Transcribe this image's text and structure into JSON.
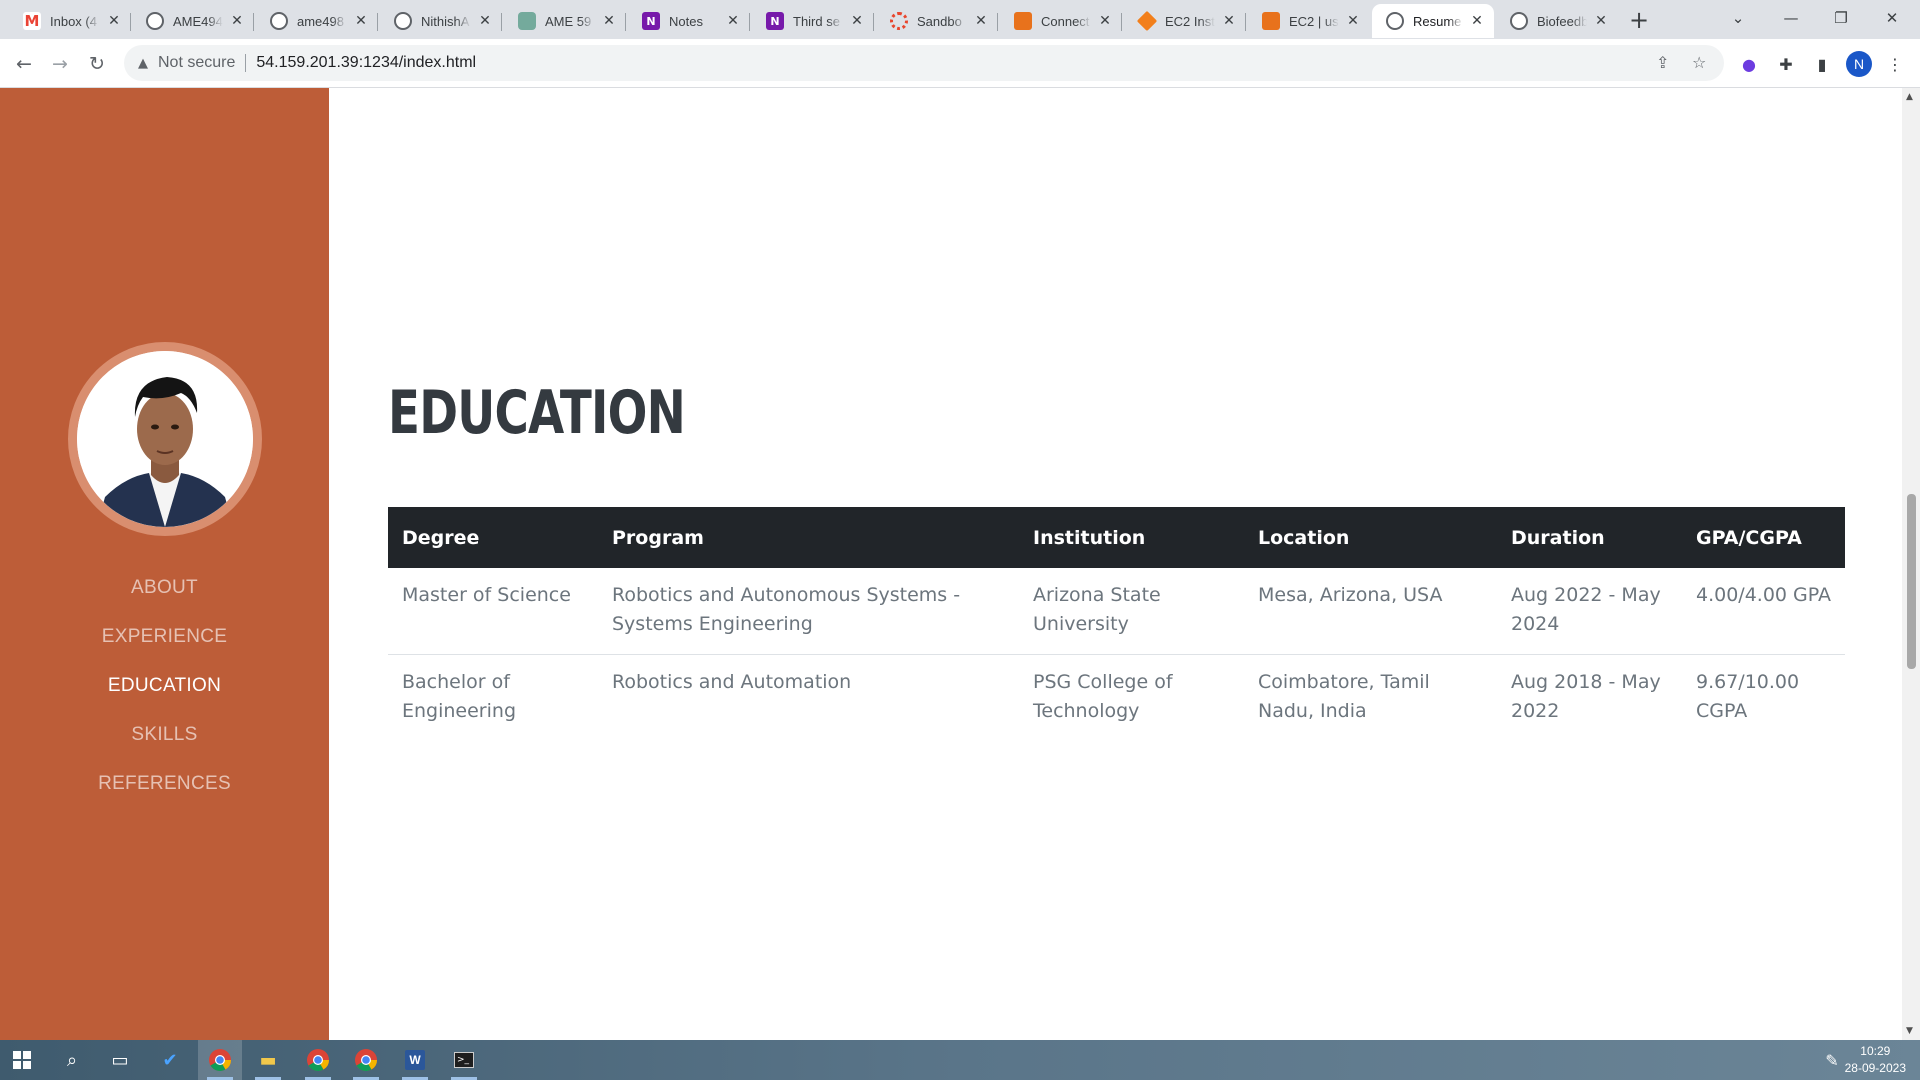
{
  "browser": {
    "tabs": [
      {
        "title": "Inbox (4",
        "icon": "gmail-icon"
      },
      {
        "title": "AME494",
        "icon": "github-icon"
      },
      {
        "title": "ame498",
        "icon": "github-icon"
      },
      {
        "title": "NithishA",
        "icon": "github-icon"
      },
      {
        "title": "AME 59",
        "icon": "chatgpt-icon"
      },
      {
        "title": "Notes",
        "icon": "onenote-icon"
      },
      {
        "title": "Third se",
        "icon": "onenote-icon"
      },
      {
        "title": "Sandbo",
        "icon": "sandbox-icon"
      },
      {
        "title": "Connect",
        "icon": "aws-icon"
      },
      {
        "title": "EC2 Inst",
        "icon": "ec2-icon"
      },
      {
        "title": "EC2 | us",
        "icon": "aws-icon"
      },
      {
        "title": "Resume",
        "icon": "globe-icon",
        "active": true
      },
      {
        "title": "Biofeedb",
        "icon": "github-icon"
      }
    ],
    "security_label": "Not secure",
    "url": "54.159.201.39:1234/index.html",
    "profile_initial": "N"
  },
  "sidebar": {
    "nav": [
      {
        "label": "ABOUT",
        "active": false
      },
      {
        "label": "EXPERIENCE",
        "active": false
      },
      {
        "label": "EDUCATION",
        "active": true
      },
      {
        "label": "SKILLS",
        "active": false
      },
      {
        "label": "REFERENCES",
        "active": false
      }
    ]
  },
  "education": {
    "heading": "EDUCATION",
    "columns": [
      "Degree",
      "Program",
      "Institution",
      "Location",
      "Duration",
      "GPA/CGPA"
    ],
    "rows": [
      [
        "Master of Science",
        "Robotics and Autonomous Systems - Systems Engineering",
        "Arizona State University",
        "Mesa, Arizona, USA",
        "Aug 2022 - May 2024",
        "4.00/4.00 GPA"
      ],
      [
        "Bachelor of Engineering",
        "Robotics and Automation",
        "PSG College of Technology",
        "Coimbatore, Tamil Nadu, India",
        "Aug 2018 - May 2022",
        "9.67/10.00 CGPA"
      ]
    ]
  },
  "taskbar": {
    "time": "10:29",
    "date": "28-09-2023"
  },
  "colors": {
    "sidebar": "#bd5d38",
    "table_header": "#212529",
    "heading": "#343a40"
  }
}
